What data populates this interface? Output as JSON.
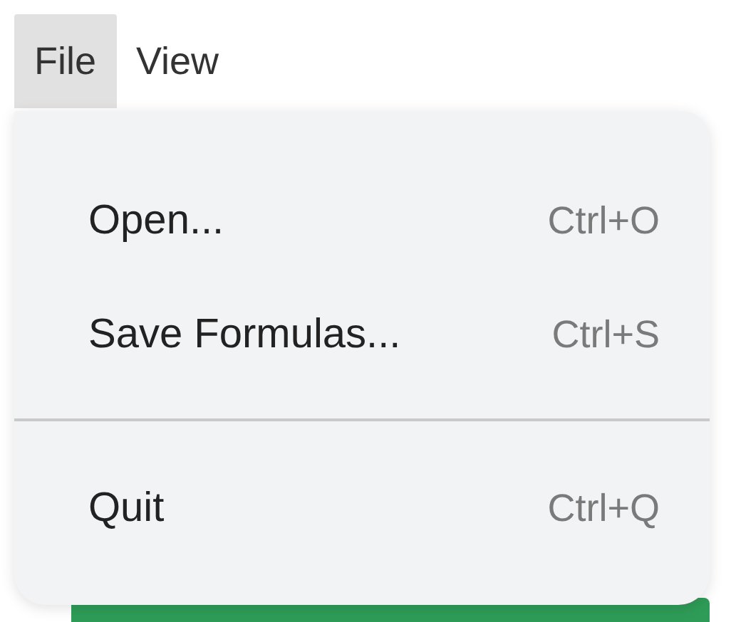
{
  "menubar": [
    {
      "label": "File",
      "selected": true
    },
    {
      "label": "View",
      "selected": false
    }
  ],
  "menu": {
    "items": [
      {
        "kind": "item",
        "label": "Open...",
        "shortcut": "Ctrl+O"
      },
      {
        "kind": "item",
        "label": "Save Formulas...",
        "shortcut": "Ctrl+S"
      },
      {
        "kind": "separator"
      },
      {
        "kind": "item",
        "label": "Quit",
        "shortcut": "Ctrl+Q"
      }
    ]
  }
}
